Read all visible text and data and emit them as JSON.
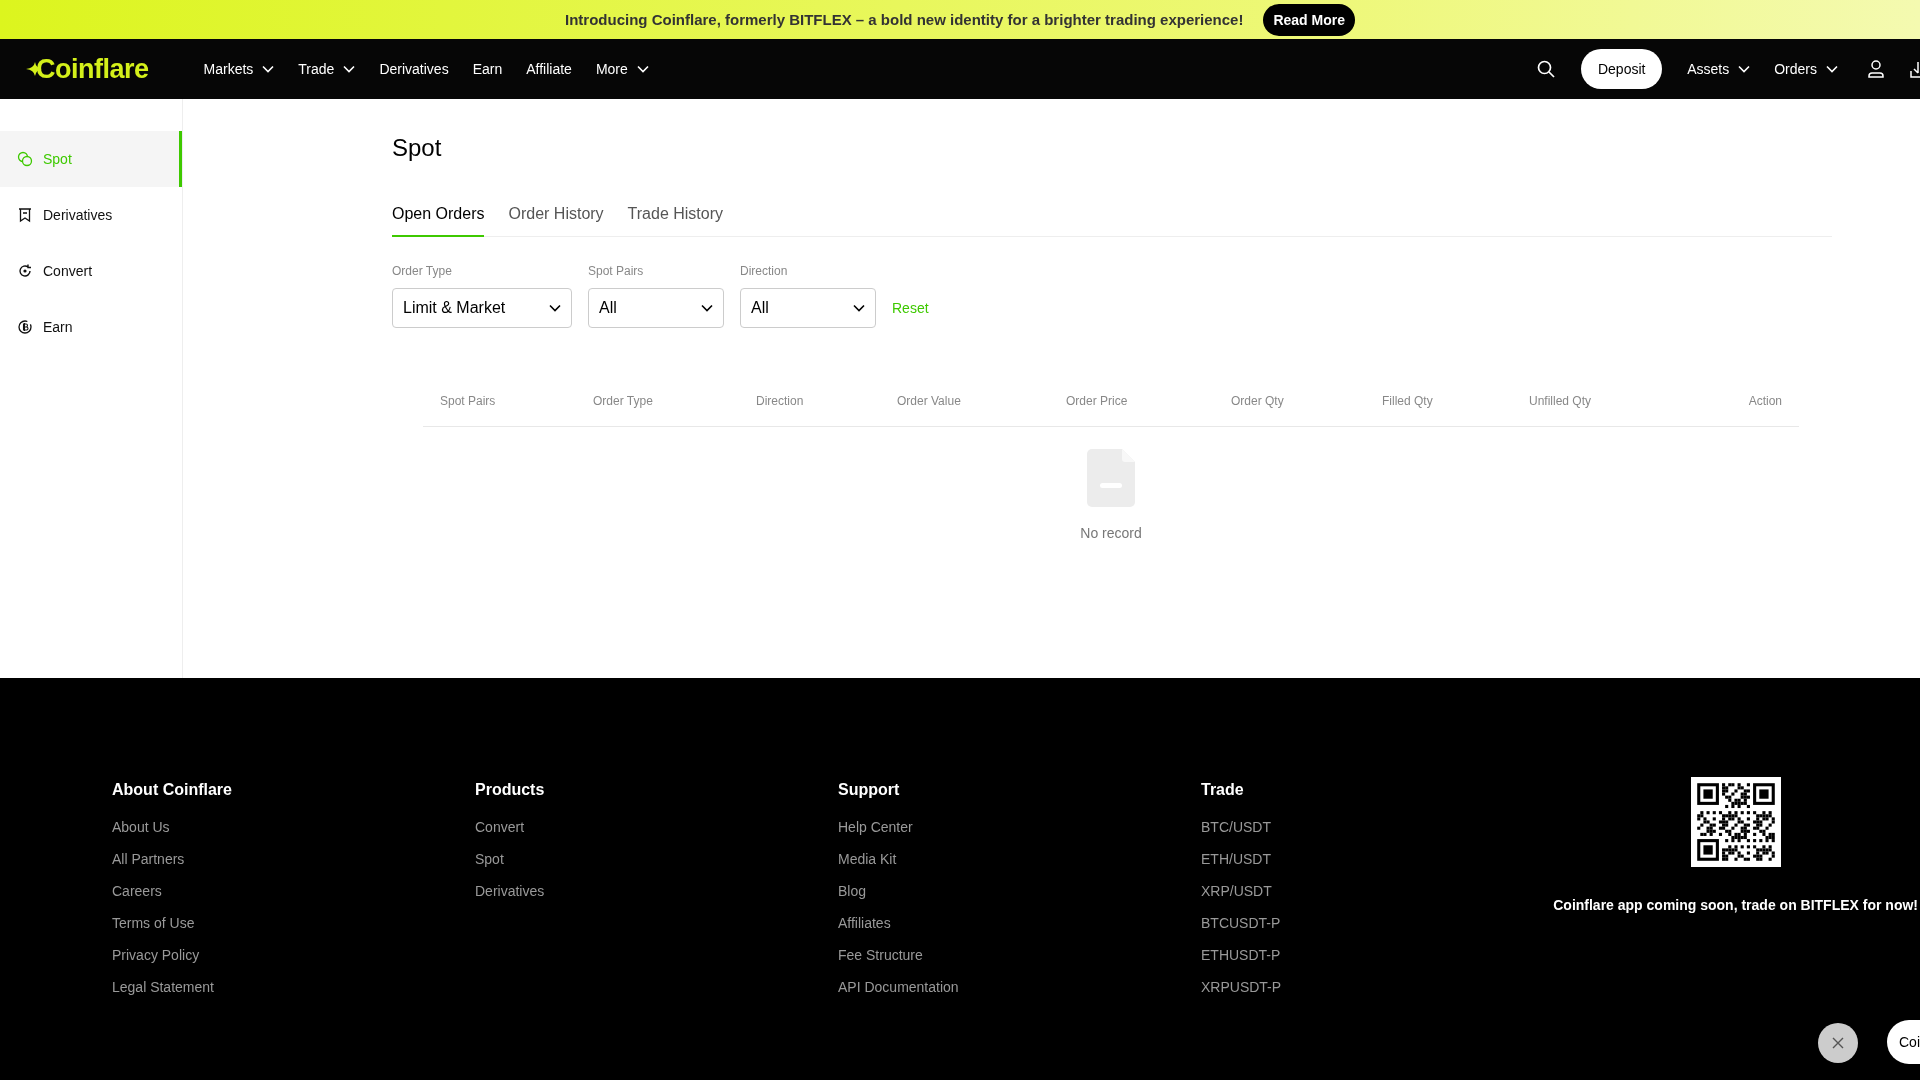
{
  "banner": {
    "text": "Introducing Coinflare, formerly BITFLEX – a bold new identity for a brighter trading experience!",
    "button": "Read More"
  },
  "nav": {
    "logo": "Coinflare",
    "items": [
      {
        "label": "Markets",
        "dropdown": true
      },
      {
        "label": "Trade",
        "dropdown": true
      },
      {
        "label": "Derivatives",
        "dropdown": false
      },
      {
        "label": "Earn",
        "dropdown": false
      },
      {
        "label": "Affiliate",
        "dropdown": false
      },
      {
        "label": "More",
        "dropdown": true
      }
    ],
    "deposit": "Deposit",
    "right_items": [
      {
        "label": "Assets",
        "dropdown": true
      },
      {
        "label": "Orders",
        "dropdown": true
      }
    ]
  },
  "sidebar": {
    "items": [
      {
        "label": "Spot",
        "kind": "spot",
        "selected": true
      },
      {
        "label": "Derivatives",
        "kind": "derivatives",
        "selected": false
      },
      {
        "label": "Convert",
        "kind": "convert",
        "selected": false
      },
      {
        "label": "Earn",
        "kind": "earn",
        "selected": false
      }
    ]
  },
  "page_title": "Spot",
  "tabs": [
    {
      "label": "Open Orders",
      "selected": true
    },
    {
      "label": "Order History",
      "selected": false
    },
    {
      "label": "Trade History",
      "selected": false
    }
  ],
  "filters": [
    {
      "label": "Order Type",
      "value": "Limit & Market"
    },
    {
      "label": "Spot Pairs",
      "value": "All"
    },
    {
      "label": "Direction",
      "value": "All"
    }
  ],
  "reset": "Reset",
  "table": {
    "columns": [
      "Spot Pairs",
      "Order Type",
      "Direction",
      "Order Value",
      "Order Price",
      "Order Qty",
      "Filled Qty",
      "Unfilled Qty",
      "Action"
    ],
    "empty_text": "No record"
  },
  "footer": {
    "columns": [
      {
        "heading": "About Coinflare",
        "links": [
          "About Us",
          "All Partners",
          "Careers",
          "Terms of Use",
          "Privacy Policy",
          "Legal Statement"
        ]
      },
      {
        "heading": "Products",
        "links": [
          "Convert",
          "Spot",
          "Derivatives"
        ]
      },
      {
        "heading": "Support",
        "links": [
          "Help Center",
          "Media Kit",
          "Blog",
          "Affiliates",
          "Fee Structure",
          "API Documentation"
        ]
      },
      {
        "heading": "Trade",
        "links": [
          "BTC/USDT",
          "ETH/USDT",
          "XRP/USDT",
          "BTCUSDT-P",
          "ETHUSDT-P",
          "XRPUSDT-P"
        ]
      }
    ],
    "app_text": "Coinflare app coming soon, trade on BITFLEX for now!"
  },
  "chat": {
    "label": "Coi"
  }
}
